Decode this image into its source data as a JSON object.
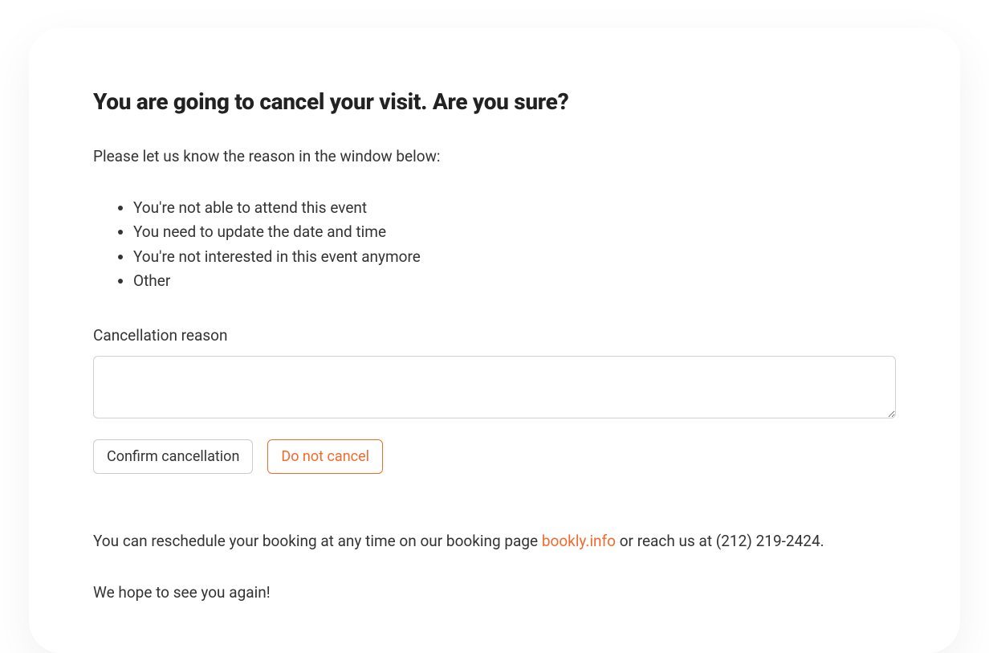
{
  "heading": "You are going to cancel your visit. Are you sure?",
  "intro": "Please let us know the reason in the window below:",
  "reasons": [
    "You're not able to attend this event",
    "You need to update the date and time",
    "You're not interested in this event anymore",
    "Other"
  ],
  "field": {
    "label": "Cancellation reason",
    "value": ""
  },
  "buttons": {
    "confirm": "Confirm cancellation",
    "cancel": "Do not cancel"
  },
  "footer": {
    "reschedule_prefix": "You can reschedule your booking at any time on our booking page ",
    "link_text": "bookly.info",
    "reschedule_suffix": " or reach us at (212) 219-2424.",
    "closing": "We hope to see you again!"
  },
  "colors": {
    "accent": "#f26a2e"
  }
}
